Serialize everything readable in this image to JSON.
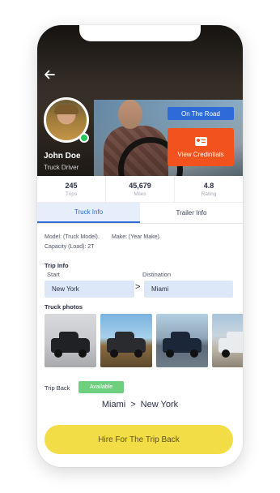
{
  "profile": {
    "name": "John Doe",
    "role": "Truck Driver",
    "status": "On The Road",
    "credentials_label": "View Credintials"
  },
  "stats": [
    {
      "value": "245",
      "label": "Trips"
    },
    {
      "value": "45,679",
      "label": "Miles"
    },
    {
      "value": "4.8",
      "label": "Rating"
    }
  ],
  "tabs": [
    {
      "label": "Truck Info",
      "active": true
    },
    {
      "label": "Trailer Info",
      "active": false
    }
  ],
  "truck": {
    "model_line": "Model: (Truck Model).",
    "make_line": "Make: (Year Make).",
    "capacity_line": "Capacity (Load): 2T"
  },
  "trip_info": {
    "title": "Trip Info",
    "start_label": "Start",
    "destination_label": "Distination",
    "start_value": "New York",
    "destination_value": "Miami",
    "arrow": ">"
  },
  "photos": {
    "title": "Truck photos",
    "items": [
      "truck-photo-1",
      "truck-photo-2",
      "truck-photo-3",
      "truck-photo-4"
    ]
  },
  "trip_back": {
    "label": "Trip Back",
    "status": "Available",
    "from": "Miami",
    "separator": ">",
    "to": "New York"
  },
  "hire_button": "Hire For The Trip Back",
  "colors": {
    "accent_blue": "#2e6ad8",
    "credentials_orange": "#f2531e",
    "available_green": "#6ed07e",
    "hire_yellow": "#f3dd47",
    "online_green": "#29c65a"
  },
  "icons": {
    "back": "arrow-left-icon",
    "credentials": "id-card-icon",
    "online": "online-status-icon"
  }
}
